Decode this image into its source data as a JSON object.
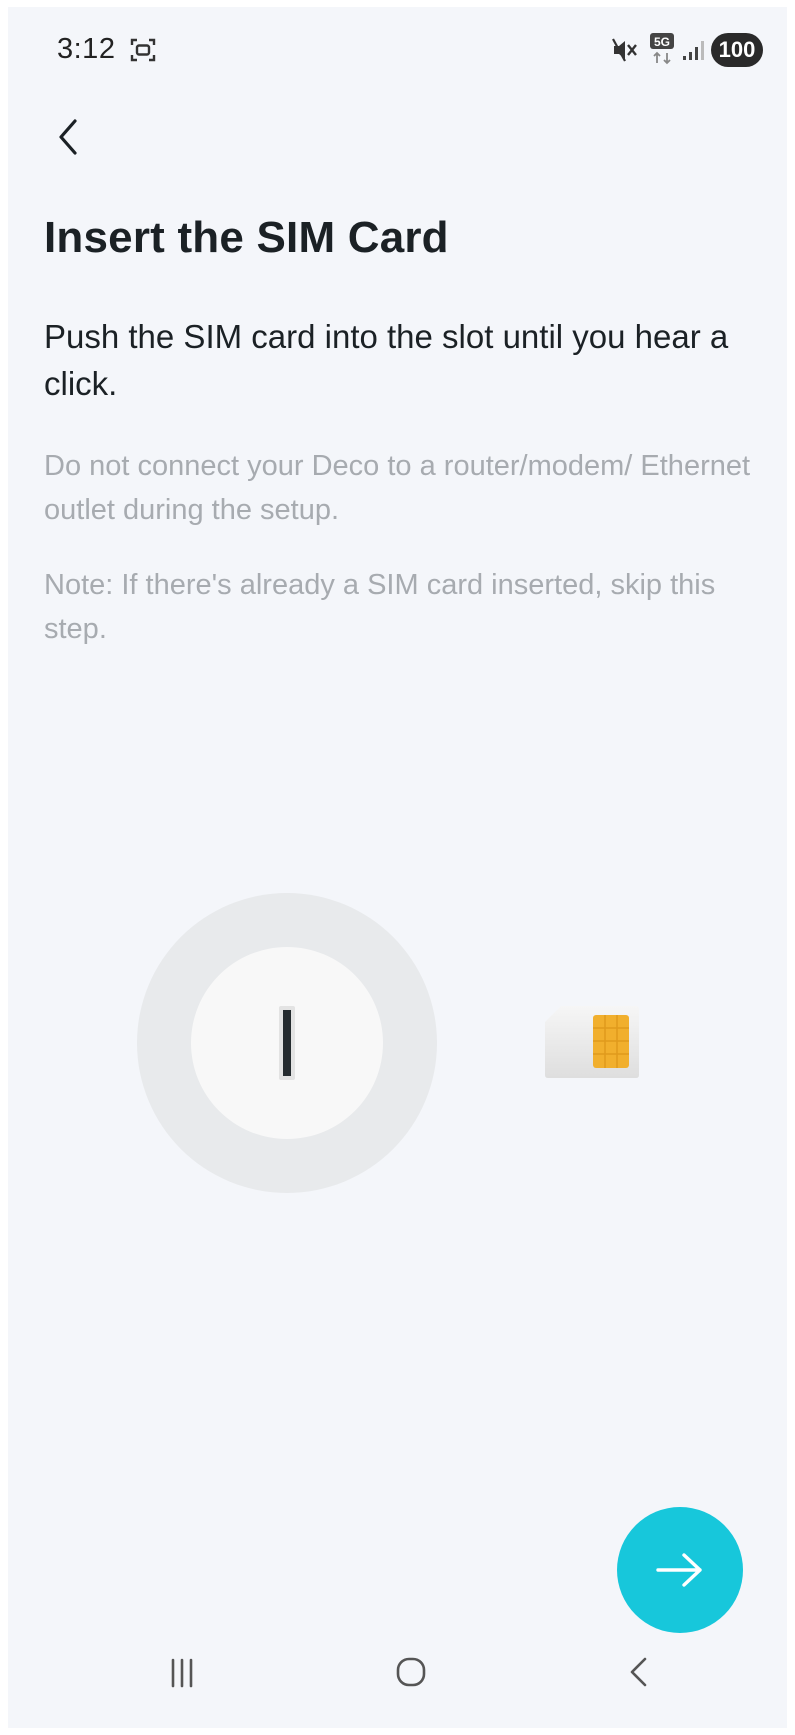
{
  "status_bar": {
    "time": "3:12",
    "battery": "100",
    "network": "5G",
    "icons": [
      "screenshot-icon",
      "mute-icon",
      "5g-icon",
      "signal-icon"
    ]
  },
  "header": {
    "back_icon": "chevron-left-icon"
  },
  "content": {
    "title": "Insert the SIM Card",
    "instruction": "Push the SIM card into the slot until you hear a click.",
    "warning": "Do not connect your Deco to a router/modem/ Ethernet outlet during the setup.",
    "note": "Note: If there's already a SIM card inserted, skip this step."
  },
  "illustration": {
    "device": "deco-device",
    "sim": "sim-card",
    "chip_color": "#F1AF2D"
  },
  "actions": {
    "next_icon": "arrow-right-icon",
    "accent_color": "#17C7DB"
  },
  "nav_bar": {
    "items": [
      "recent-apps-icon",
      "home-icon",
      "back-icon"
    ]
  }
}
